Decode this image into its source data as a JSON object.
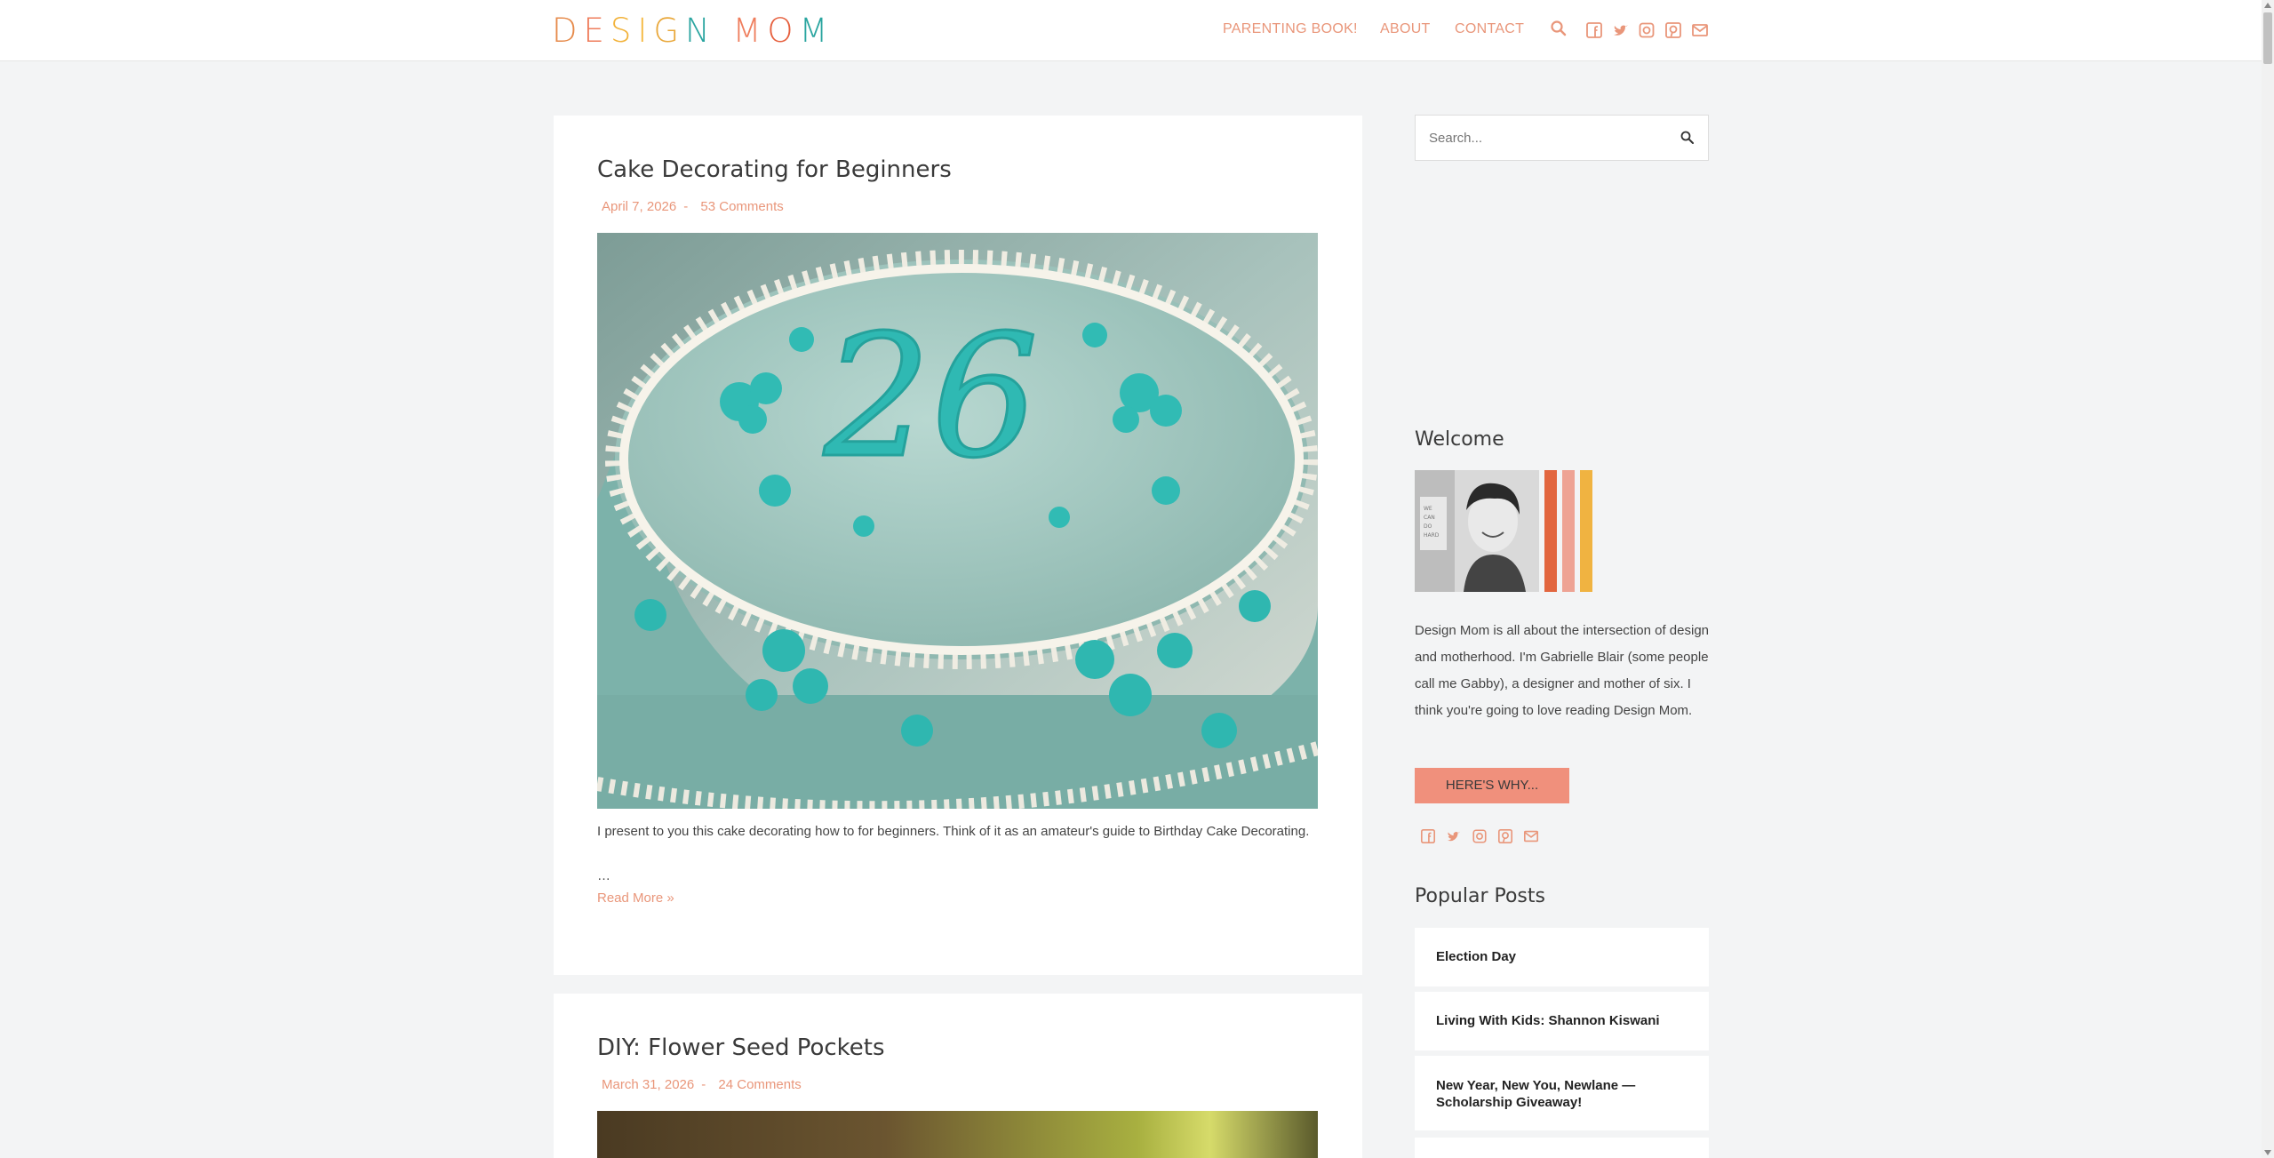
{
  "header": {
    "logo_letters": [
      {
        "ch": "D",
        "color": "#e68a4a"
      },
      {
        "ch": "E",
        "color": "#ef7d5c"
      },
      {
        "ch": "S",
        "color": "#f2b23a"
      },
      {
        "ch": "I",
        "color": "#f4b940"
      },
      {
        "ch": "G",
        "color": "#e9a83b"
      },
      {
        "ch": "N",
        "color": "#2aa5a0"
      },
      {
        "ch": " ",
        "color": "#ffffff"
      },
      {
        "ch": "M",
        "color": "#ef7d5c"
      },
      {
        "ch": "O",
        "color": "#e65f3d"
      },
      {
        "ch": "M",
        "color": "#2aa5a0"
      }
    ],
    "nav": {
      "book": "PARENTING BOOK!",
      "about": "ABOUT",
      "contact": "CONTACT"
    },
    "icons": [
      "search-icon",
      "facebook-icon",
      "twitter-icon",
      "instagram-icon",
      "pinterest-icon",
      "email-icon"
    ],
    "accent": "#e9967a"
  },
  "posts": [
    {
      "title": "Cake Decorating for Beginners",
      "date": "April 7, 2026",
      "separator": "-",
      "comments": "53 Comments",
      "excerpt": "I present to you this cake decorating how to for beginners. Think of it as an amateur's guide to Birthday Cake Decorating.",
      "ellipsis": "…",
      "read_more": "Read More »"
    },
    {
      "title": "DIY: Flower Seed Pockets",
      "date": "March 31, 2026",
      "separator": "-",
      "comments": "24 Comments"
    }
  ],
  "sidebar": {
    "search_placeholder": "Search...",
    "welcome_title": "Welcome",
    "welcome_text": "Design Mom is all about the intersection of design and motherhood. I'm Gabrielle Blair (some people call me Gabby), a designer and mother of six. I think you're going to love reading Design Mom.",
    "heres_why": "HERE'S WHY...",
    "popular_title": "Popular Posts",
    "popular_posts": [
      "Election Day",
      "Living With Kids: Shannon Kiswani",
      "New Year, New You, Newlane — Scholarship Giveaway!"
    ],
    "photo_stripes": [
      "#e2663f",
      "#eea394",
      "#f0b341"
    ]
  }
}
